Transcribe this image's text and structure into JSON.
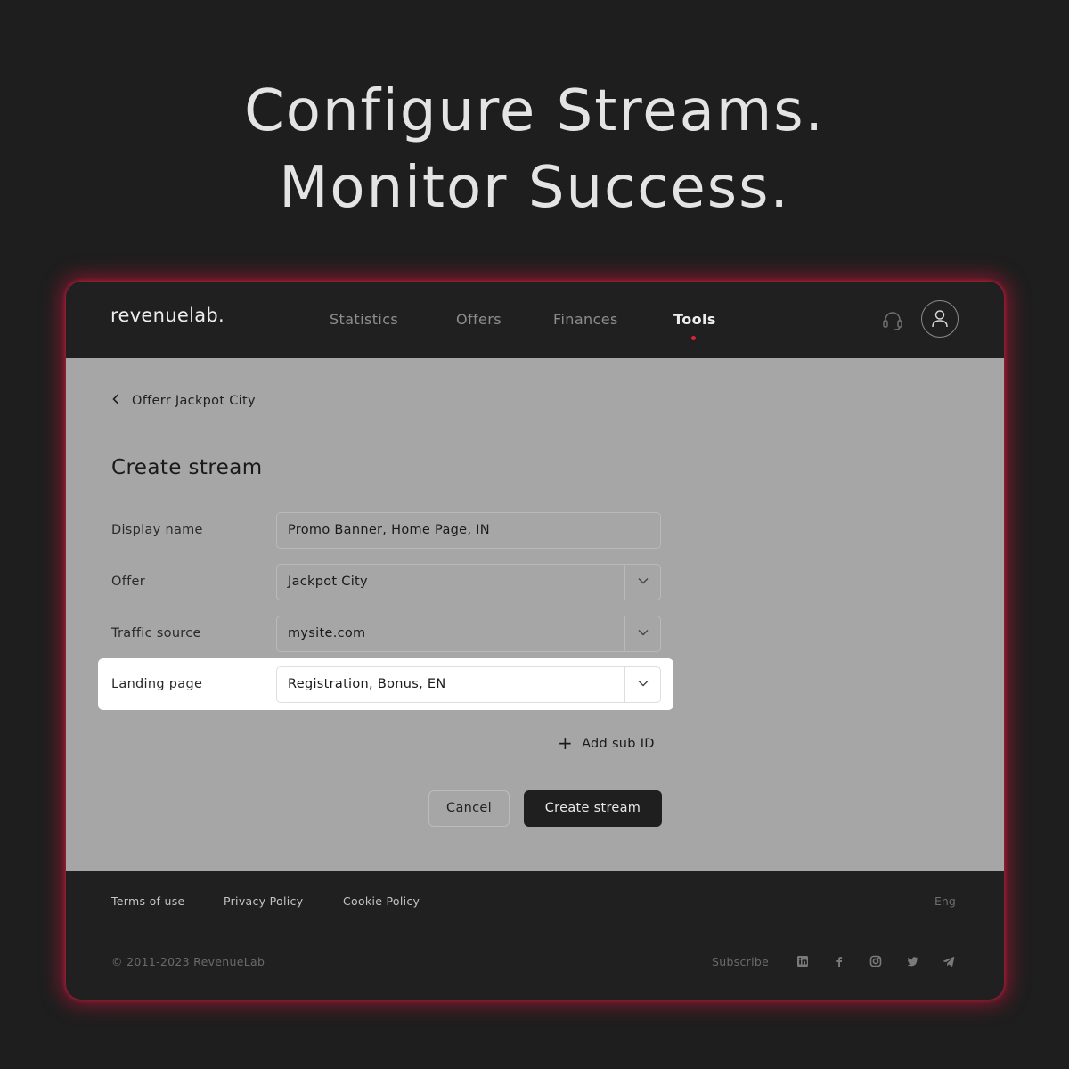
{
  "headline": {
    "line1": "Configure Streams.",
    "line2": "Monitor Success."
  },
  "header": {
    "logo": "revenuelab.",
    "nav": [
      {
        "label": "Statistics",
        "active": false
      },
      {
        "label": "Offers",
        "active": false
      },
      {
        "label": "Finances",
        "active": false
      },
      {
        "label": "Tools",
        "active": true
      }
    ],
    "icons": {
      "support": "headset-icon",
      "profile": "user-icon"
    }
  },
  "breadcrumb": {
    "label": "Offerr Jackpot City",
    "icon": "chevron-left-icon"
  },
  "page_title": "Create stream",
  "form": {
    "fields": [
      {
        "label": "Display name",
        "value": "Promo Banner, Home Page, IN",
        "type": "text"
      },
      {
        "label": "Offer",
        "value": "Jackpot City",
        "type": "select"
      },
      {
        "label": "Traffic source",
        "value": "mysite.com",
        "type": "select"
      },
      {
        "label": "Landing page",
        "value": "Registration, Bonus, EN",
        "type": "select",
        "highlighted": true
      }
    ],
    "add_sub_id": "Add sub ID",
    "cancel_label": "Cancel",
    "submit_label": "Create stream"
  },
  "footer": {
    "links": [
      "Terms of use",
      "Privacy Policy",
      "Cookie Policy"
    ],
    "language": "Eng",
    "copyright": "© 2011-2023 RevenueLab",
    "subscribe": "Subscribe",
    "social_icons": [
      "linkedin-icon",
      "facebook-icon",
      "instagram-icon",
      "twitter-icon",
      "telegram-icon"
    ]
  },
  "colors": {
    "background": "#1e1e1e",
    "accent_glow": "#d2143c",
    "content_bg": "#a6a6a6",
    "primary_button": "#1f1f1f"
  }
}
